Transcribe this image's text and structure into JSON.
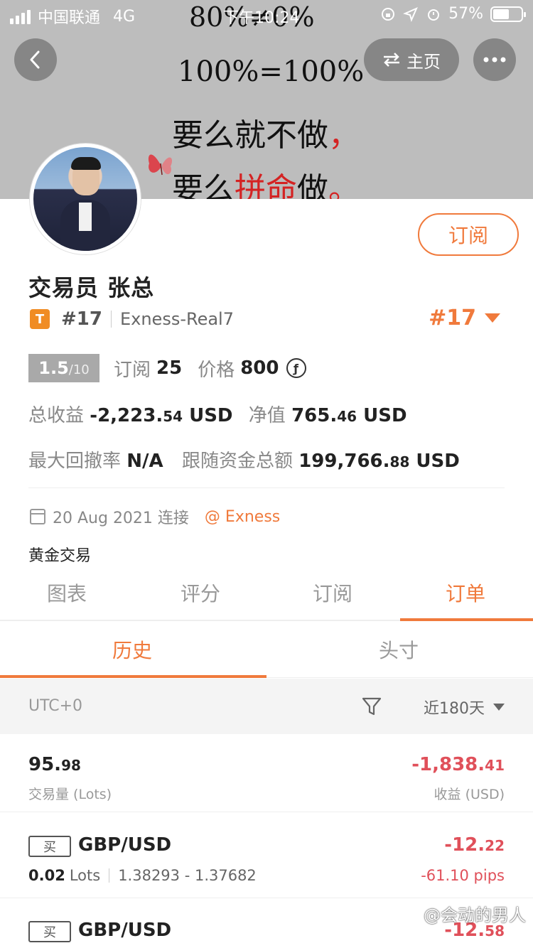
{
  "status_bar": {
    "carrier": "中国联通",
    "network": "4G",
    "time": "下午10:24",
    "battery": "57%",
    "battery_level": 0.57
  },
  "banner": {
    "slogan_line1": "80%≠0%",
    "slogan_line2": "100%=100%",
    "slogan_line3_a": "要么就不做",
    "slogan_line3_b": "，",
    "slogan_line4_a": "要么",
    "slogan_line4_b": "拼命",
    "slogan_line4_c": "做",
    "slogan_line4_d": "。"
  },
  "header": {
    "home_label": "主页"
  },
  "profile": {
    "subscribe_label": "订阅",
    "name": "交易员 张总",
    "rank_badge": "T",
    "rank": "#17",
    "account": "Exness-Real7",
    "rank_right": "#17",
    "score_int": "1.5",
    "score_max": "/10",
    "subs_label": "订阅",
    "subs_value": "25",
    "price_label": "价格",
    "price_value": "800",
    "price_coin": "ƒ",
    "total_profit_label": "总收益",
    "total_profit_int": "-2,223.",
    "total_profit_dec": "54",
    "total_profit_unit": " USD",
    "equity_label": "净值",
    "equity_int": "765.",
    "equity_dec": "46",
    "equity_unit": " USD",
    "drawdown_label": "最大回撤率",
    "drawdown_value": "N/A",
    "follow_label": "跟随资金总额",
    "follow_int": "199,766.",
    "follow_dec": "88",
    "follow_unit": " USD",
    "join_date": "20 Aug 2021 连接",
    "broker": "@ Exness",
    "description": "黄金交易"
  },
  "tabs": [
    {
      "label": "图表"
    },
    {
      "label": "评分"
    },
    {
      "label": "订阅"
    },
    {
      "label": "订单"
    }
  ],
  "subtabs": [
    {
      "label": "历史"
    },
    {
      "label": "头寸"
    }
  ],
  "filter": {
    "timezone": "UTC+0",
    "range": "近180天"
  },
  "summary": {
    "volume_int": "95.",
    "volume_dec": "98",
    "volume_label": "交易量 (Lots)",
    "profit_int": "-1,838.",
    "profit_dec": "41",
    "profit_label": "收益 (USD)"
  },
  "orders": [
    {
      "side": "买",
      "pair": "GBP/USD",
      "lots": "0.02",
      "lots_unit": "Lots",
      "prices": "1.38293 - 1.37682",
      "pl_int": "-12.",
      "pl_dec": "22",
      "pips": "-61.10 pips"
    },
    {
      "side": "买",
      "pair": "GBP/USD",
      "pl_int": "-12.",
      "pl_dec": "58"
    }
  ],
  "watermark": "@会动的男人",
  "colors": {
    "accent": "#f07a3c",
    "loss": "#e0505a"
  }
}
